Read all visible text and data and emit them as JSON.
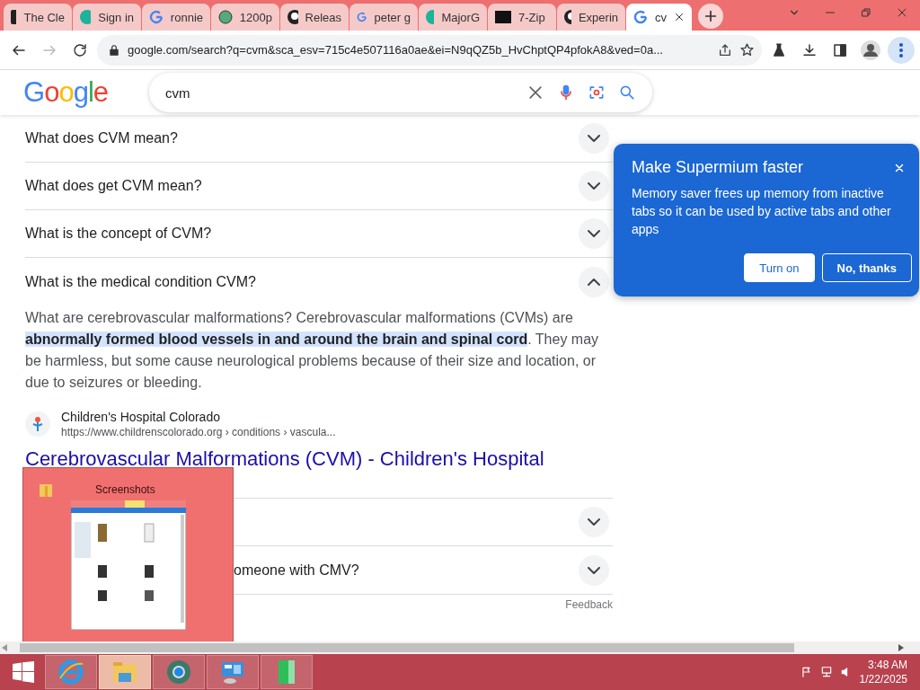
{
  "tabs": [
    {
      "title": "The Cle",
      "selected": false
    },
    {
      "title": "Sign in",
      "selected": false
    },
    {
      "title": "ronnie",
      "selected": false
    },
    {
      "title": "1200p",
      "selected": false
    },
    {
      "title": "Releas",
      "selected": false
    },
    {
      "title": "peter g",
      "selected": false
    },
    {
      "title": "MajorG",
      "selected": false
    },
    {
      "title": "7-Zip",
      "selected": false
    },
    {
      "title": "Experin",
      "selected": false
    },
    {
      "title": "cv",
      "selected": true
    }
  ],
  "address": "google.com/search?q=cvm&sca_esv=715c4e507116a0ae&ei=N9qQZ5b_HvChptQP4pfokA8&ved=0a...",
  "search": {
    "logo": "Google",
    "query": "cvm"
  },
  "faq_top": [
    {
      "question": "What does CVM mean?",
      "expanded": false
    },
    {
      "question": "What does get CVM mean?",
      "expanded": false
    },
    {
      "question": "What is the concept of CVM?",
      "expanded": false
    },
    {
      "question": "What is the medical condition CVM?",
      "expanded": true
    }
  ],
  "answer": "What are cerebrovascular malformations? Cerebrovascular malformations (CVMs) are **abnormally formed blood vessels in and around the brain and spinal cord**. They may be harmless, but some cause neurological problems because of their size and location, or due to seizures or bleeding.",
  "source": {
    "site": "Children's Hospital Colorado",
    "url": "https://www.childrenscolorado.org › conditions › vascula...",
    "title": "Cerebrovascular Malformations (CVM) - Children's Hospital"
  },
  "faq_bottom": [
    {
      "expanded": false
    },
    {
      "question": "omeone with CMV?",
      "expanded": false
    }
  ],
  "feedback": "Feedback",
  "popup": {
    "title": "Make Supermium faster",
    "body": "Memory saver frees up memory from inactive tabs so it can be used by active tabs and other apps",
    "buttons": [
      {
        "label": "Turn on",
        "kind": "primary"
      },
      {
        "label": "No, thanks",
        "kind": "outline"
      }
    ]
  },
  "thumbnail": {
    "title": "Screenshots"
  },
  "taskbar": {
    "apps": [
      {
        "active": false
      },
      {
        "active": true
      },
      {
        "active": false
      },
      {
        "active": false
      },
      {
        "active": false
      }
    ],
    "time": "3:48 AM",
    "date": "1/22/2025"
  }
}
